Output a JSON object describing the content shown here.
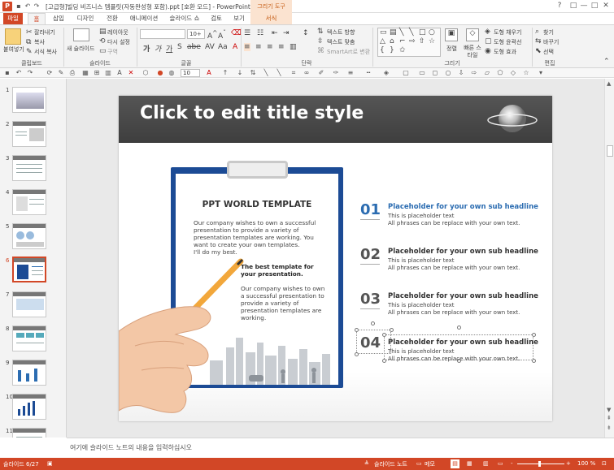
{
  "window": {
    "title": "[고급형]빌딩 비즈니스 템플릿(자동완성형 포함).ppt [호환 모드] - PowerPoint",
    "contextual_group": "그리기 도구",
    "app_icon": "P",
    "controls": {
      "help": "?",
      "restore": "□",
      "minimize": "—",
      "maximize": "□",
      "close": "✕"
    }
  },
  "tabs": [
    {
      "label": "파일"
    },
    {
      "label": "홈"
    },
    {
      "label": "삽입"
    },
    {
      "label": "디자인"
    },
    {
      "label": "전환"
    },
    {
      "label": "애니메이션"
    },
    {
      "label": "슬라이드 쇼"
    },
    {
      "label": "검토"
    },
    {
      "label": "보기"
    },
    {
      "label": "서식"
    }
  ],
  "ribbon": {
    "clipboard": {
      "paste": "붙여넣기",
      "cut": "잘라내기",
      "copy": "복사",
      "format_painter": "서식 복사",
      "group": "클립보드"
    },
    "slides": {
      "new_slide": "새 슬라이드",
      "layout": "레이아웃",
      "reset": "다시 설정",
      "section": "구역",
      "group": "슬라이드"
    },
    "font": {
      "size": "10+",
      "group": "글꼴"
    },
    "paragraph": {
      "text_direction": "텍스트 방향",
      "align_text": "텍스트 맞춤",
      "smartart": "SmartArt로 변환",
      "group": "단락"
    },
    "drawing": {
      "arrange": "정렬",
      "quick_styles": "빠른 스타일",
      "shape_fill": "도형 채우기",
      "shape_outline": "도형 윤곽선",
      "shape_effects": "도형 효과",
      "group": "그리기"
    },
    "editing": {
      "find": "찾기",
      "replace": "바꾸기",
      "select": "선택",
      "group": "편집"
    }
  },
  "toolbar2": {
    "font_size": "10"
  },
  "thumbnails": [
    {
      "num": "1"
    },
    {
      "num": "2"
    },
    {
      "num": "3"
    },
    {
      "num": "4"
    },
    {
      "num": "5"
    },
    {
      "num": "6"
    },
    {
      "num": "7"
    },
    {
      "num": "8"
    },
    {
      "num": "9"
    },
    {
      "num": "10"
    },
    {
      "num": "11"
    }
  ],
  "slide": {
    "title": "Click to edit title style",
    "clipboard": {
      "heading": "PPT WORLD TEMPLATE",
      "body": "Our company wishes to own a successful presentation to provide a variety of presentation templates are working. You want to create your own templates.\nI'll do my best.",
      "bold": "The best template for your presentation.",
      "body2": "Our company wishes to own a successful presentation to provide a variety of presentation templates are working."
    },
    "items": [
      {
        "num": "01",
        "headline": "Placeholder  for your own sub headline",
        "line1": "This is placeholder text",
        "line2": "All phrases can be replace with your own text."
      },
      {
        "num": "02",
        "headline": "Placeholder  for your own sub headline",
        "line1": "This is placeholder text",
        "line2": "All phrases can be replace with your own text."
      },
      {
        "num": "03",
        "headline": "Placeholder  for your own sub headline",
        "line1": "This is placeholder text",
        "line2": "All phrases can be replace with your own text."
      },
      {
        "num": "04",
        "headline": "Placeholder  for your own sub headline",
        "line1": "This is placeholder text",
        "line2": "All phrases can be replace with your own text."
      }
    ]
  },
  "notes": {
    "placeholder": "여기에 슬라이드 노트의 내용을 입력하십시오"
  },
  "status": {
    "slide_info": "슬라이드 6/27",
    "notes": "슬라이드 노트",
    "memo": "메모",
    "zoom": "100 %",
    "minus": "-",
    "plus": "+"
  },
  "colors": {
    "accent": "#d24726",
    "ribbon_bg": "#f3f3f3",
    "slide_header": "#4a4a4a",
    "clipboard_blue": "#1c4b95",
    "highlight_blue": "#2b6cb1"
  }
}
